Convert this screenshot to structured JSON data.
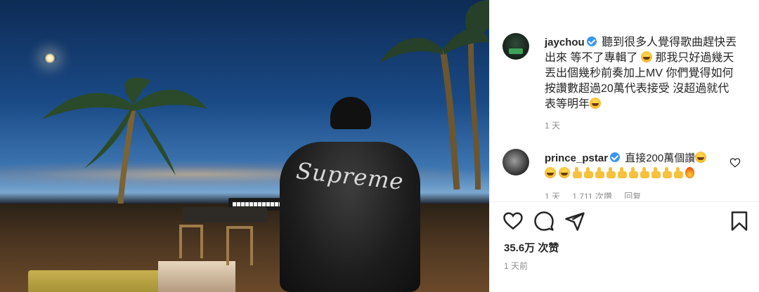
{
  "caption": {
    "username": "jaychou",
    "text_line1": "聽到很多人覺得歌曲趕快丟",
    "text_line2": "出來 等不了專輯了",
    "text_line3": " 那我只好過幾天",
    "text_line4": "丟出個幾秒前奏加上MV 你們覺得如何",
    "text_line5": "按讚數超過20萬代表接受 沒超過就代",
    "text_line6": "表等明年",
    "time": "1 天"
  },
  "comment": {
    "username": "prince_pstar",
    "text": "直接200萬個讚",
    "likes": "1,711 次讚",
    "time": "1 天",
    "reply": "回复"
  },
  "post": {
    "likes": "35.6万 次赞",
    "time": "1 天前"
  },
  "photo": {
    "jacket_text": "Supreme"
  },
  "icons": {
    "like": "heart-icon",
    "comment": "comment-icon",
    "share": "share-icon",
    "save": "bookmark-icon"
  },
  "colors": {
    "verified": "#3897f0",
    "muted": "#8e8e8e",
    "text": "#262626"
  }
}
